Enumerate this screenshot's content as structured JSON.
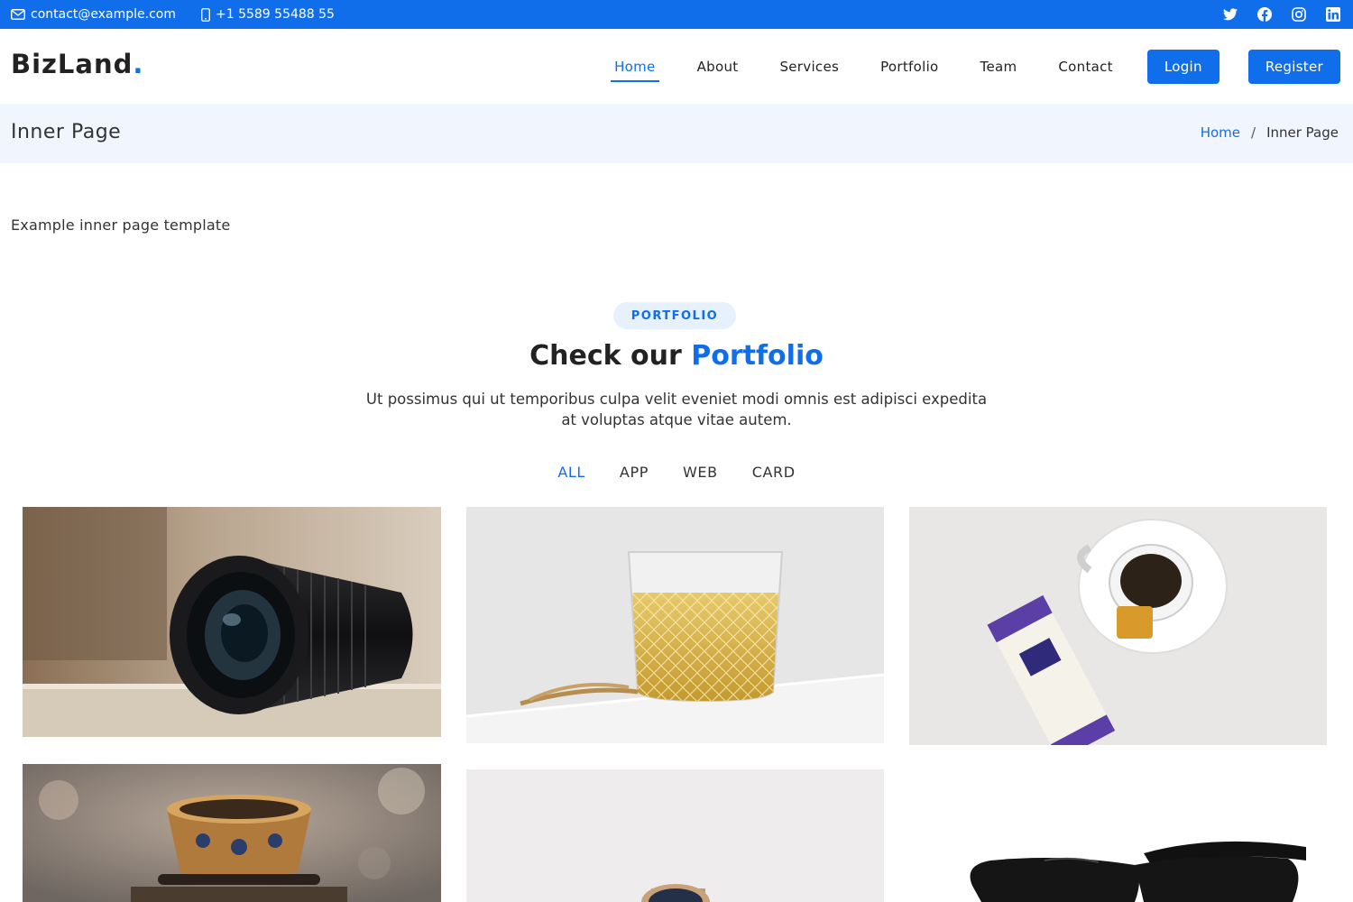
{
  "topbar": {
    "email": "contact@example.com",
    "phone": "+1 5589 55488 55",
    "social_icons": [
      "twitter-icon",
      "facebook-icon",
      "instagram-icon",
      "linkedin-icon"
    ]
  },
  "header": {
    "logo_text": "BizLand",
    "logo_dot": ".",
    "nav": [
      {
        "label": "Home",
        "active": true
      },
      {
        "label": "About"
      },
      {
        "label": "Services"
      },
      {
        "label": "Portfolio"
      },
      {
        "label": "Team"
      },
      {
        "label": "Contact"
      }
    ],
    "login_label": "Login",
    "register_label": "Register"
  },
  "breadcrumbs": {
    "title": "Inner Page",
    "home": "Home",
    "separator": "/",
    "current": "Inner Page"
  },
  "intro_text": "Example inner page template",
  "portfolio": {
    "badge": "PORTFOLIO",
    "title_plain": "Check our ",
    "title_accent": "Portfolio",
    "description": "Ut possimus qui ut temporibus culpa velit eveniet modi omnis est adipisci expedita at voluptas atque vitae autem.",
    "filters": [
      "ALL",
      "APP",
      "WEB",
      "CARD"
    ],
    "active_filter": "ALL",
    "items": [
      "camera-lens-image",
      "glass-of-tea-image",
      "honeycomb-package-image",
      "ornate-cup-image",
      "wristwatch-image",
      "sunglasses-image"
    ]
  },
  "colors": {
    "accent": "#106eea",
    "breadcrumb_bg": "#f1f6fe",
    "badge_bg": "#e7f1fd"
  }
}
